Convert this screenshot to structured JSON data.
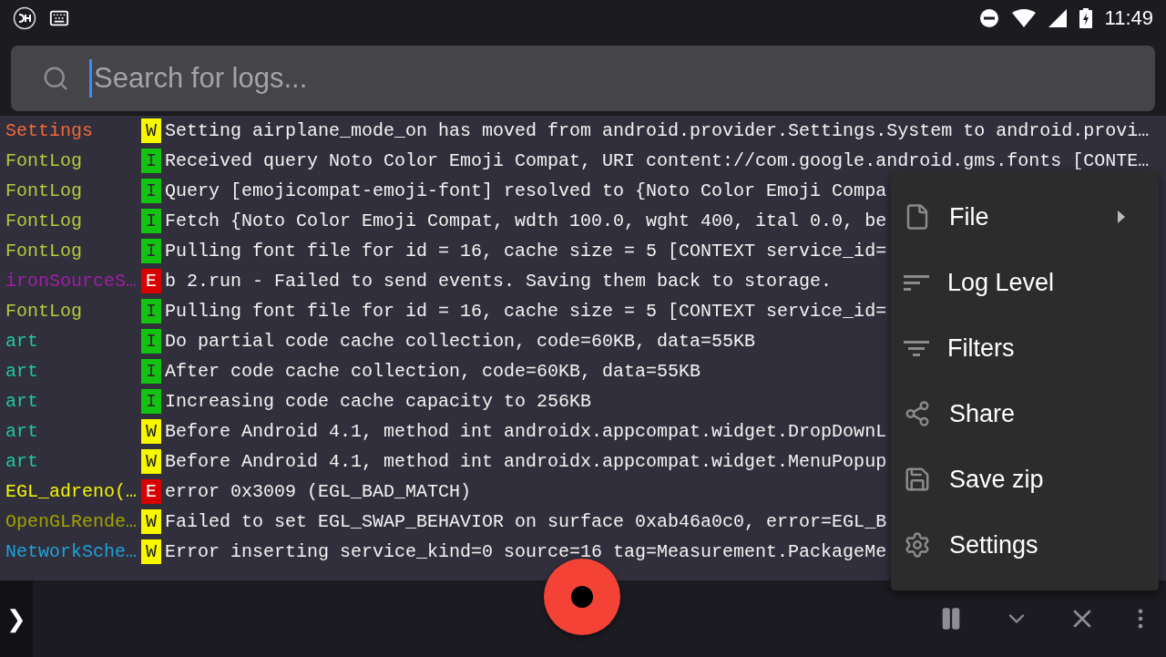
{
  "status_bar": {
    "time": "11:49"
  },
  "search": {
    "placeholder": "Search for logs..."
  },
  "log": [
    {
      "tag": "Settings",
      "color": "#f26a3b",
      "kind": "warn",
      "letter": "W",
      "message": "Setting airplane_mode_on has moved from android.provider.Settings.System to android.provi…"
    },
    {
      "tag": "FontLog",
      "color": "#b3cc3a",
      "kind": "info",
      "letter": "I",
      "message": "Received query Noto Color Emoji Compat, URI content://com.google.android.gms.fonts [CONTE…"
    },
    {
      "tag": "FontLog",
      "color": "#b3cc3a",
      "kind": "info",
      "letter": "I",
      "message": "Query [emojicompat-emoji-font] resolved to {Noto Color Emoji Compa"
    },
    {
      "tag": "FontLog",
      "color": "#b3cc3a",
      "kind": "info",
      "letter": "I",
      "message": "Fetch {Noto Color Emoji Compat, wdth 100.0, wght 400, ital 0.0, be"
    },
    {
      "tag": "FontLog",
      "color": "#b3cc3a",
      "kind": "info",
      "letter": "I",
      "message": "Pulling font file for id = 16, cache size = 5 [CONTEXT service_id="
    },
    {
      "tag": "ironSourceS…",
      "color": "#a21ea6",
      "kind": "error",
      "letter": "E",
      "message": "b 2.run - Failed to send events. Saving them back to storage."
    },
    {
      "tag": "FontLog",
      "color": "#b3cc3a",
      "kind": "info",
      "letter": "I",
      "message": "Pulling font file for id = 16, cache size = 5 [CONTEXT service_id="
    },
    {
      "tag": "art",
      "color": "#1ec8a0",
      "kind": "info",
      "letter": "I",
      "message": "Do partial code cache collection, code=60KB, data=55KB"
    },
    {
      "tag": "art",
      "color": "#1ec8a0",
      "kind": "info",
      "letter": "I",
      "message": "After code cache collection, code=60KB, data=55KB"
    },
    {
      "tag": "art",
      "color": "#1ec8a0",
      "kind": "info",
      "letter": "I",
      "message": "Increasing code cache capacity to 256KB"
    },
    {
      "tag": "art",
      "color": "#1ec8a0",
      "kind": "warn",
      "letter": "W",
      "message": "Before Android 4.1, method int androidx.appcompat.widget.DropDownL"
    },
    {
      "tag": "art",
      "color": "#1ec8a0",
      "kind": "warn",
      "letter": "W",
      "message": "Before Android 4.1, method int androidx.appcompat.widget.MenuPopup"
    },
    {
      "tag": "EGL_adreno(…",
      "color": "#f5f500",
      "kind": "error",
      "letter": "E",
      "message": "error 0x3009 (EGL_BAD_MATCH)"
    },
    {
      "tag": "OpenGLRende…",
      "color": "#a3a300",
      "kind": "warn",
      "letter": "W",
      "message": "Failed to set EGL_SWAP_BEHAVIOR on surface 0xab46a0c0, error=EGL_B"
    },
    {
      "tag": "NetworkSche…",
      "color": "#1ea2dc",
      "kind": "warn",
      "letter": "W",
      "message": "Error inserting service_kind=0 source=16 tag=Measurement.PackageMe"
    }
  ],
  "menu": [
    {
      "kind": "file",
      "label": "File",
      "submenu": true
    },
    {
      "kind": "level",
      "label": "Log Level",
      "submenu": false
    },
    {
      "kind": "filters",
      "label": "Filters",
      "submenu": false
    },
    {
      "kind": "share",
      "label": "Share",
      "submenu": false
    },
    {
      "kind": "save",
      "label": "Save zip",
      "submenu": false
    },
    {
      "kind": "settings",
      "label": "Settings",
      "submenu": false
    }
  ],
  "bottom_bar": {
    "expand": "❯"
  }
}
